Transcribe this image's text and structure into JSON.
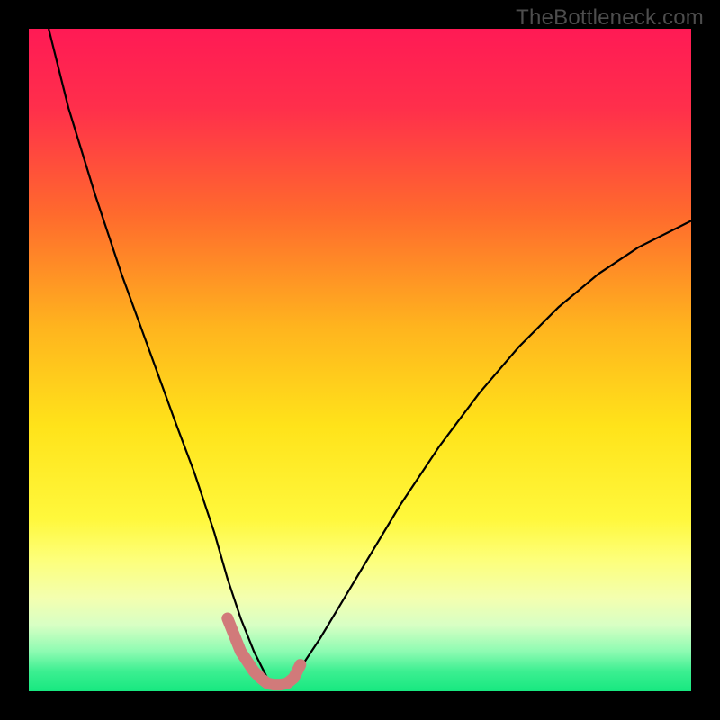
{
  "watermark": "TheBottleneck.com",
  "chart_data": {
    "type": "line",
    "title": "",
    "xlabel": "",
    "ylabel": "",
    "xlim": [
      0,
      100
    ],
    "ylim": [
      0,
      100
    ],
    "gradient_stops": [
      {
        "pct": 0,
        "color": "#ff1a55"
      },
      {
        "pct": 12,
        "color": "#ff2f4b"
      },
      {
        "pct": 28,
        "color": "#ff6a2d"
      },
      {
        "pct": 45,
        "color": "#ffb41e"
      },
      {
        "pct": 60,
        "color": "#ffe31a"
      },
      {
        "pct": 74,
        "color": "#fff83c"
      },
      {
        "pct": 80,
        "color": "#fdff79"
      },
      {
        "pct": 86,
        "color": "#f3ffb0"
      },
      {
        "pct": 90,
        "color": "#d8ffc4"
      },
      {
        "pct": 94,
        "color": "#8dfbb2"
      },
      {
        "pct": 97,
        "color": "#3cef91"
      },
      {
        "pct": 100,
        "color": "#17e880"
      }
    ],
    "series": [
      {
        "name": "bottleneck-curve",
        "stroke": "#000000",
        "stroke_width": 2.2,
        "x": [
          3,
          6,
          10,
          14,
          18,
          22,
          25,
          28,
          30,
          32,
          34,
          36,
          38,
          40,
          44,
          50,
          56,
          62,
          68,
          74,
          80,
          86,
          92,
          98,
          100
        ],
        "values": [
          100,
          88,
          75,
          63,
          52,
          41,
          33,
          24,
          17,
          11,
          6,
          2,
          0.5,
          2,
          8,
          18,
          28,
          37,
          45,
          52,
          58,
          63,
          67,
          70,
          71
        ]
      },
      {
        "name": "highlight-band",
        "stroke": "#d17a7a",
        "stroke_width": 13,
        "linecap": "round",
        "x": [
          30,
          32,
          34,
          35,
          36,
          37,
          38,
          39,
          40,
          41
        ],
        "values": [
          11,
          6,
          3,
          2,
          1.2,
          1,
          1,
          1.2,
          2,
          4
        ]
      }
    ]
  }
}
